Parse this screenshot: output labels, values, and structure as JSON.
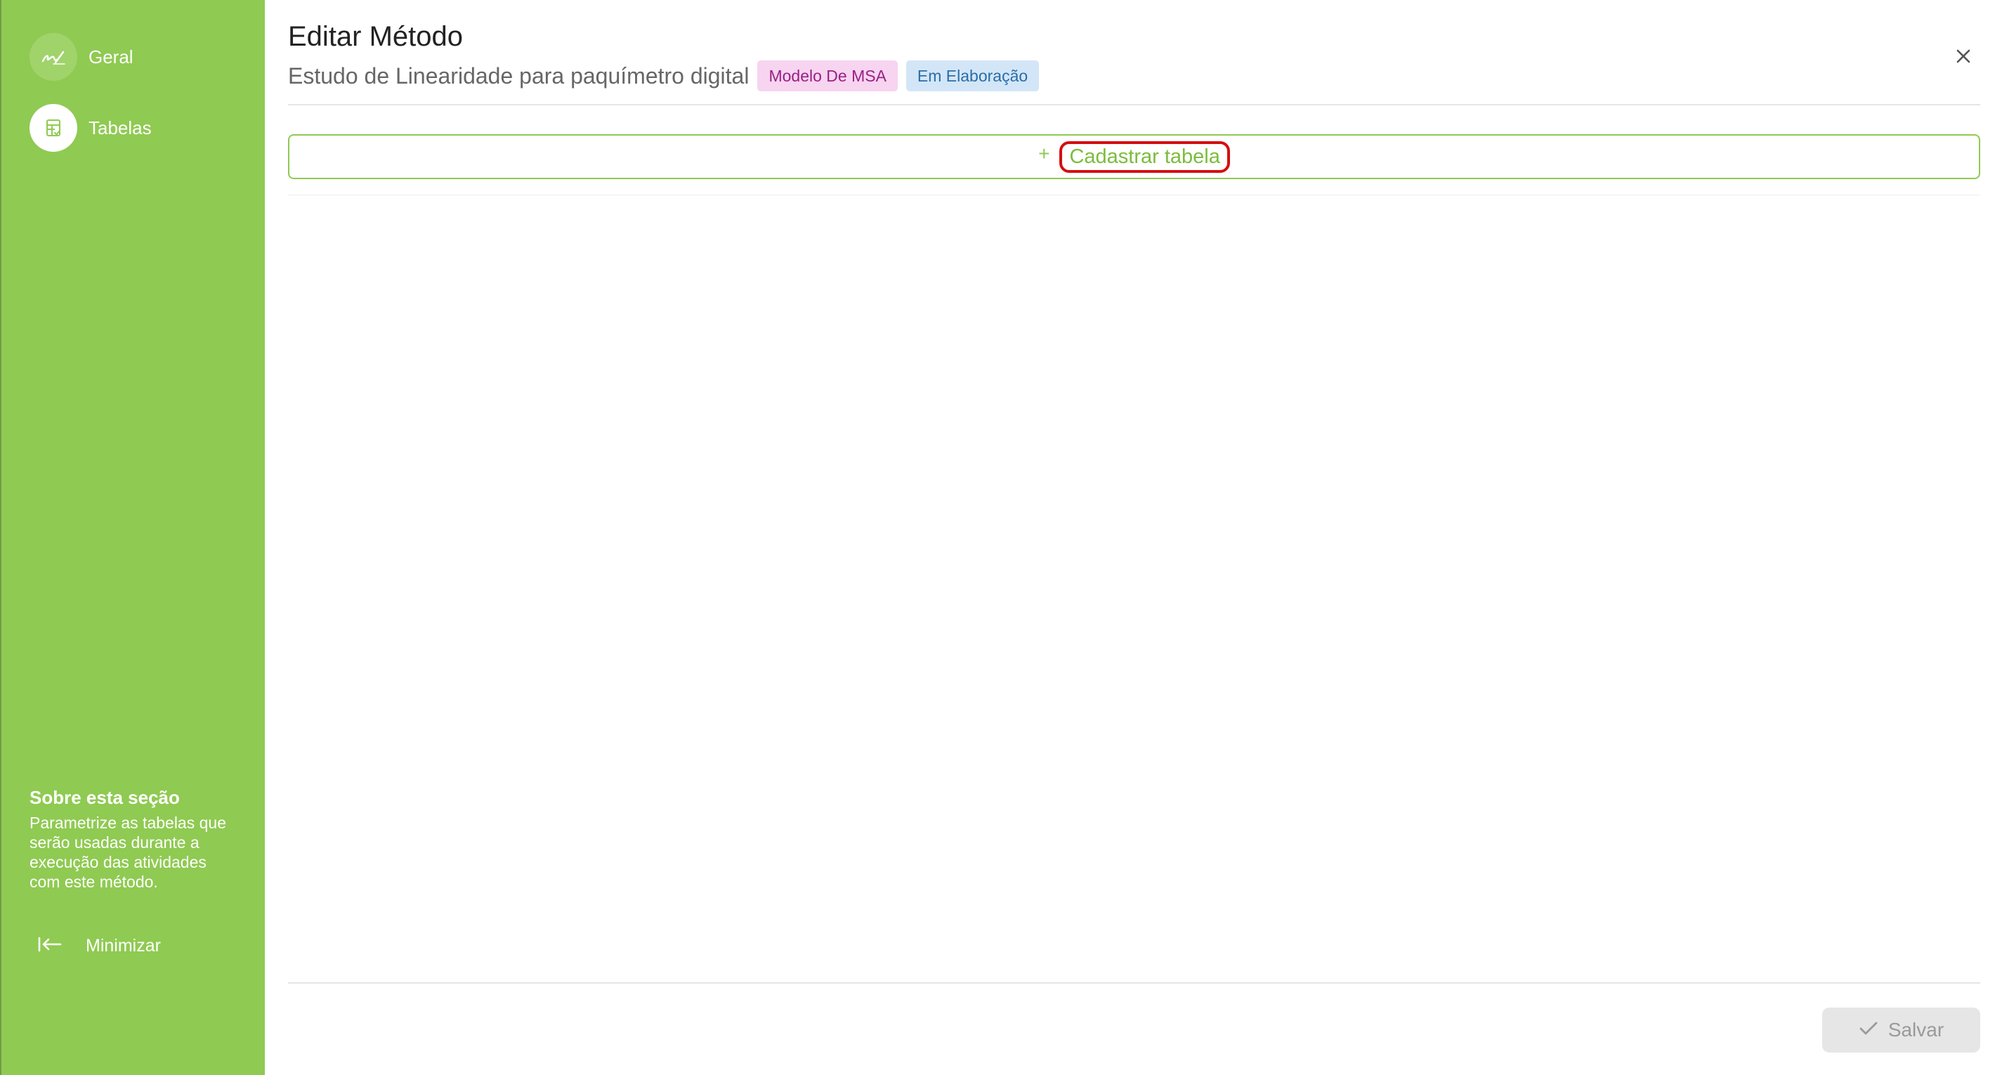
{
  "sidebar": {
    "items": [
      {
        "label": "Geral",
        "icon": "signature-icon",
        "active": false
      },
      {
        "label": "Tabelas",
        "icon": "table-icon",
        "active": true
      }
    ],
    "about": {
      "title": "Sobre esta seção",
      "text": "Parametrize as tabelas que serão usadas durante a execução das atividades com este método."
    },
    "minimize_label": "Minimizar"
  },
  "header": {
    "title": "Editar Método",
    "subtitle": "Estudo de Linearidade para paquímetro digital",
    "badges": [
      {
        "label": "Modelo De MSA",
        "color": "#9a1f86",
        "background": "#f7d4ef"
      },
      {
        "label": "Em Elaboração",
        "color": "#2a6ea8",
        "background": "#d3e6f7"
      }
    ]
  },
  "main": {
    "add_table_plus": "+",
    "add_table_label": "Cadastrar tabela"
  },
  "footer": {
    "save_label": "Salvar"
  },
  "colors": {
    "sidebar": "#8fca52",
    "accent": "#7cbc3c",
    "highlight": "#d40f0f"
  }
}
